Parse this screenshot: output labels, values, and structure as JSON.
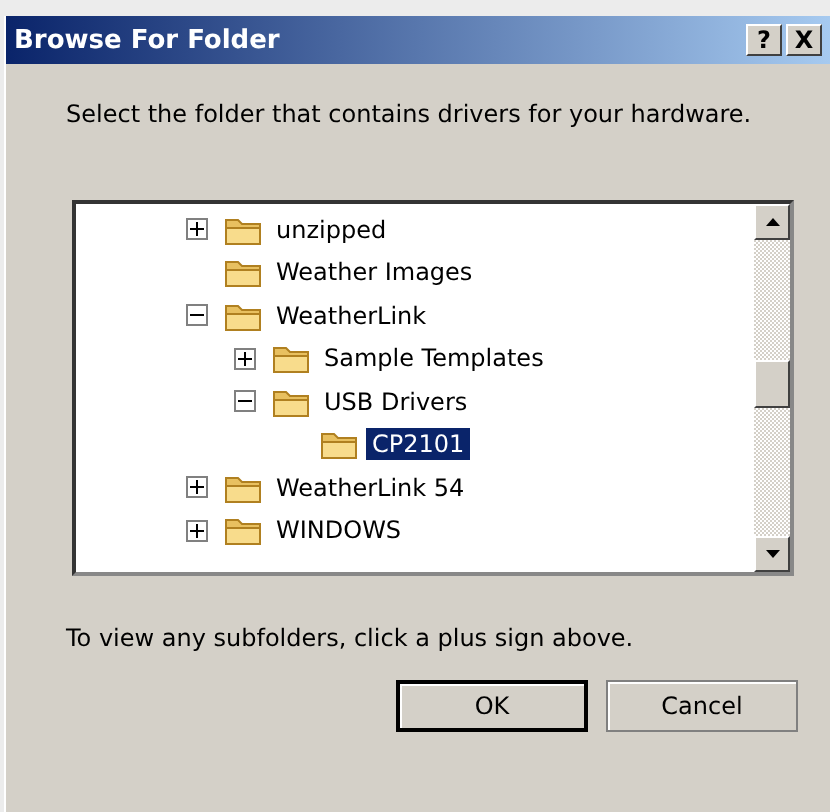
{
  "window": {
    "title": "Browse For Folder",
    "help_button": "?",
    "close_button": "X"
  },
  "instruction": "Select the folder that contains drivers for your hardware.",
  "tree": [
    {
      "label": "unzipped",
      "expanded": false,
      "selected": false
    },
    {
      "label": "Weather Images",
      "selected": false
    },
    {
      "label": "WeatherLink",
      "expanded": true,
      "selected": false,
      "children": [
        {
          "label": "Sample Templates",
          "expanded": false,
          "selected": false
        },
        {
          "label": "USB Drivers",
          "expanded": true,
          "selected": false,
          "children": [
            {
              "label": "CP2101",
              "selected": true
            }
          ]
        }
      ]
    },
    {
      "label": "WeatherLink 54",
      "expanded": false,
      "selected": false
    },
    {
      "label": "WINDOWS",
      "expanded": false,
      "selected": false
    }
  ],
  "hint": "To view any subfolders, click a plus sign above.",
  "buttons": [
    {
      "label": "OK",
      "default": true
    },
    {
      "label": "Cancel",
      "default": false
    }
  ]
}
